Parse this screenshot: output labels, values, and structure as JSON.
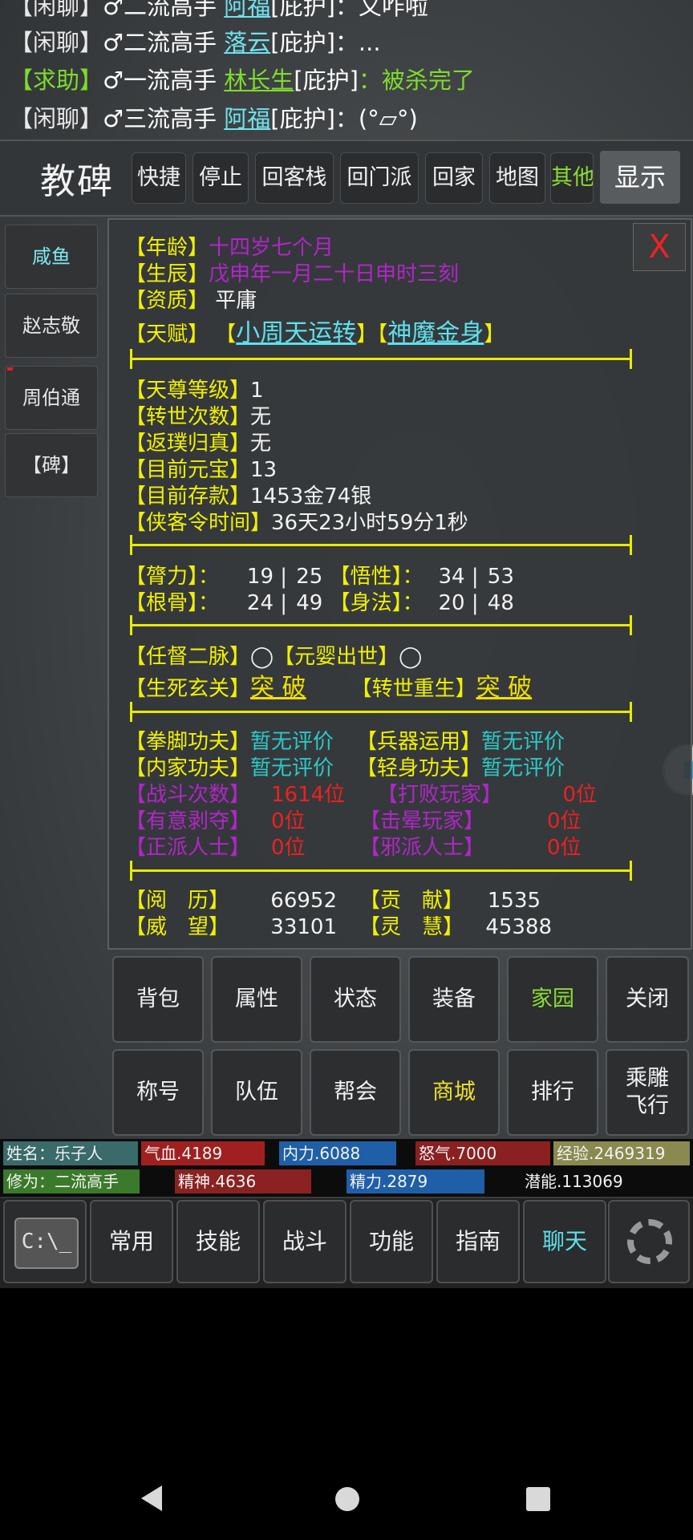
{
  "chat": [
    {
      "tag": "【闲聊】",
      "rank": "♂二流高手",
      "name": "阿福",
      "protect": "[庇护]",
      "msg": "：又咋啦",
      "tag_color": "white",
      "name_color": "cyan",
      "msg_color": "white"
    },
    {
      "tag": "【闲聊】",
      "rank": "♂二流高手",
      "name": "落云",
      "protect": "[庇护]",
      "msg": "：...",
      "tag_color": "white",
      "name_color": "cyan",
      "msg_color": "white"
    },
    {
      "tag": "【求助】",
      "rank": "♂一流高手",
      "name": "林长生",
      "protect": "[庇护]",
      "msg": "：被杀完了",
      "tag_color": "green",
      "name_color": "green",
      "msg_color": "green"
    },
    {
      "tag": "【闲聊】",
      "rank": "♂三流高手",
      "name": "阿福",
      "protect": "[庇护]",
      "msg": "：(°▱°)",
      "tag_color": "white",
      "name_color": "cyan",
      "msg_color": "white"
    }
  ],
  "topbar": {
    "title": "教碑",
    "buttons": [
      "快捷",
      "停止",
      "回客栈",
      "回门派",
      "回家",
      "地图",
      "其他"
    ],
    "show_label": "显示"
  },
  "left_tabs": [
    "咸鱼",
    "赵志敬",
    "周伯通",
    "【碑】"
  ],
  "panel": {
    "close_label": "X",
    "age_label": "【年龄】",
    "age": "十四岁七个月",
    "birth_label": "【生辰】",
    "birth": "戊申年一月二十日申时三刻",
    "aptitude_label": "【资质】",
    "aptitude": "平庸",
    "talent_label": "【天赋】",
    "talents": [
      "小周天运转",
      "神魔金身"
    ],
    "tianzun_label": "【天尊等级】",
    "tianzun": "1",
    "reincarnation_label": "【转世次数】",
    "reincarnation": "无",
    "return_label": "【返璞归真】",
    "return_val": "无",
    "yuanbao_label": "【目前元宝】",
    "yuanbao": "13",
    "deposit_label": "【目前存款】",
    "deposit": "1453金74银",
    "token_label": "【侠客令时间】",
    "token": "36天23小时59分1秒",
    "attrs": [
      {
        "label": "【膂力】：",
        "cur": "19",
        "max": "25",
        "label2": "【悟性】：",
        "cur2": "34",
        "max2": "53"
      },
      {
        "label": "【根骨】：",
        "cur": "24",
        "max": "49",
        "label2": "【身法】：",
        "cur2": "20",
        "max2": "48"
      }
    ],
    "meridian_label": "【任督二脉】",
    "meridian": "◯",
    "yuanying_label": "【元婴出世】",
    "yuanying": "◯",
    "lifedeath_label": "【生死玄关】",
    "lifedeath": "突 破",
    "rebirth_label": "【转世重生】",
    "rebirth": "突 破",
    "skills": [
      {
        "label": "【拳脚功夫】",
        "val": "暂无评价",
        "label2": "【兵器运用】",
        "val2": "暂无评价"
      },
      {
        "label": "【内家功夫】",
        "val": "暂无评价",
        "label2": "【轻身功夫】",
        "val2": "暂无评价"
      }
    ],
    "ranks": [
      {
        "label": "【战斗次数】",
        "val": "1614位",
        "label2": "【打败玩家】",
        "val2": "0位"
      },
      {
        "label": "【有意剥夺】",
        "val": "0位",
        "label2": "【击晕玩家】",
        "val2": "0位"
      },
      {
        "label": "【正派人士】",
        "val": "0位",
        "label2": "【邪派人士】",
        "val2": "0位"
      }
    ],
    "exp_label": "【阅　历】",
    "exp": "66952",
    "contrib_label": "【贡　献】",
    "contrib": "1535",
    "prestige_label": "【威　望】",
    "prestige": "33101",
    "wisdom_label": "【灵　慧】",
    "wisdom": "45388"
  },
  "menu_row1": [
    "背包",
    "属性",
    "状态",
    "装备",
    "家园",
    "关闭"
  ],
  "menu_row2": [
    "称号",
    "队伍",
    "帮会",
    "商城",
    "排行",
    "乘雕飞行"
  ],
  "status": {
    "name": "姓名：乐子人",
    "hp": "气血.4189",
    "mp": "内力.6088",
    "rage": "怒气.7000",
    "exp": "经验.2469319",
    "cult": "修为：二流高手",
    "spirit": "精神.4636",
    "energy": "精力.2879",
    "potential": "潜能.113069"
  },
  "bottomnav": [
    "常用",
    "技能",
    "战斗",
    "功能",
    "指南",
    "聊天"
  ],
  "colors": {
    "yellow": "#f0f000",
    "cyan": "#2dc8c8",
    "purple": "#b026c8",
    "red": "#ee2020",
    "green": "#7ddc2c"
  }
}
